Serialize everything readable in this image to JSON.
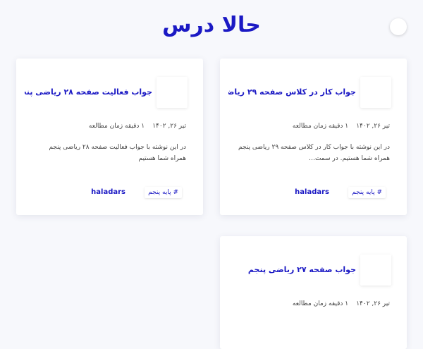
{
  "site": {
    "title": "حالا درس"
  },
  "posts": [
    {
      "title": "جواب کار در کلاس صفحه ۲۹ ریاضی پنجم",
      "date": "تیر ۲۶, ۱۴۰۲",
      "read_time": "۱ دقیقه زمان مطالعه",
      "excerpt": "در این نوشته با جواب کار در کلاس صفحه ۲۹ ریاضی پنجم همراه شما هستیم. در سمت…",
      "tag": "# پایه پنجم",
      "author": "haladars"
    },
    {
      "title": "جواب فعالیت صفحه ۲۸ ریاضی پنجم",
      "date": "تیر ۲۶, ۱۴۰۲",
      "read_time": "۱ دقیقه زمان مطالعه",
      "excerpt": "در این نوشته با جواب فعالیت صفحه ۲۸ ریاضی پنجم همراه شما هستیم",
      "tag": "# پایه پنجم",
      "author": "haladars"
    },
    {
      "title": "جواب صفحه ۲۷ ریاضی پنجم",
      "date": "تیر ۲۶, ۱۴۰۲",
      "read_time": "۱ دقیقه زمان مطالعه"
    }
  ]
}
